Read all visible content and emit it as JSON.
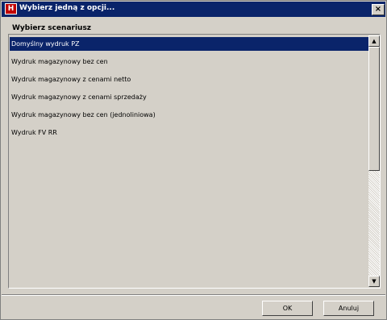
{
  "window": {
    "title": "Wybierz jedną z opcji...",
    "app_icon_text": "H",
    "close_glyph": "×"
  },
  "section": {
    "label": "Wybierz scenariusz"
  },
  "list": {
    "items": [
      {
        "label": "Domyślny wydruk PZ",
        "selected": true
      },
      {
        "label": "Wydruk magazynowy bez cen",
        "selected": false
      },
      {
        "label": "Wydruk magazynowy z cenami netto",
        "selected": false
      },
      {
        "label": "Wydruk magazynowy z cenami sprzedaży",
        "selected": false
      },
      {
        "label": "Wydruk magazynowy bez cen (jednoliniowa)",
        "selected": false
      },
      {
        "label": "Wydruk FV RR",
        "selected": false
      }
    ]
  },
  "scrollbar": {
    "up_glyph": "▲",
    "down_glyph": "▼"
  },
  "buttons": {
    "ok_label": "OK",
    "cancel_label": "Anuluj"
  },
  "colors": {
    "titlebar": "#0a246a",
    "selection": "#0a246a",
    "face": "#d4d0c8"
  }
}
